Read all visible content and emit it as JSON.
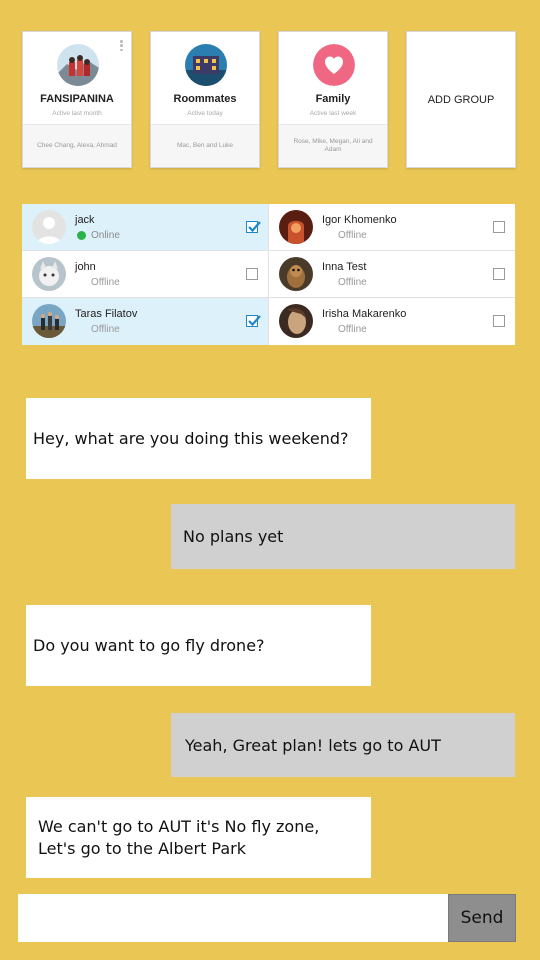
{
  "groups": [
    {
      "name": "FANSIPANINA",
      "active": "Active last month",
      "members": "Chee Chang, Alexa, Ahmad"
    },
    {
      "name": "Roommates",
      "active": "Active today",
      "members": "Mac, Ben and Luke"
    },
    {
      "name": "Family",
      "active": "Active last week",
      "members": "Rose, Mike, Megan, Ali and Adam"
    }
  ],
  "add_group_label": "ADD GROUP",
  "contacts": [
    {
      "name": "jack",
      "status": "Online",
      "checked": true
    },
    {
      "name": "Igor Khomenko",
      "status": "Offline",
      "checked": false
    },
    {
      "name": "john",
      "status": "Offline",
      "checked": false
    },
    {
      "name": "Inna Test",
      "status": "Offline",
      "checked": false
    },
    {
      "name": "Taras Filatov",
      "status": "Offline",
      "checked": true
    },
    {
      "name": "Irisha Makarenko",
      "status": "Offline",
      "checked": false
    }
  ],
  "messages": [
    {
      "side": "in",
      "text": "Hey, what are you doing this weekend?"
    },
    {
      "side": "out",
      "text": "No plans yet"
    },
    {
      "side": "in",
      "text": "Do you want to go fly drone?"
    },
    {
      "side": "out",
      "text": "Yeah, Great plan! lets go to AUT"
    },
    {
      "side": "in",
      "text": "We can't go to AUT it's No fly zone,",
      "text2": "Let's go to the Albert Park"
    }
  ],
  "composer": {
    "value": "",
    "send_label": "Send"
  },
  "colors": {
    "background": "#EAC755",
    "selected_row": "#DDF1FA",
    "online": "#2bb34a",
    "outgoing_bubble": "#D0D0D0",
    "send_button": "#8E8E8E"
  }
}
